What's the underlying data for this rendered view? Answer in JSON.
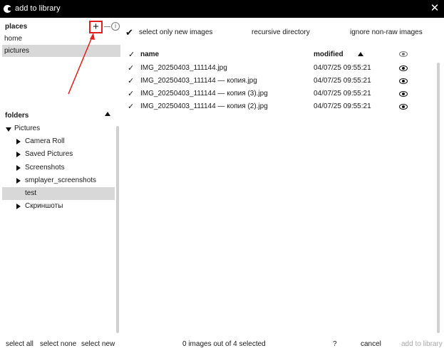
{
  "window": {
    "title": "add to library",
    "close_glyph": "✕"
  },
  "places": {
    "title": "places",
    "add_glyph": "+",
    "info_glyph": "i",
    "items": [
      {
        "label": "home",
        "selected": false
      },
      {
        "label": "pictures",
        "selected": true
      }
    ]
  },
  "folders": {
    "title": "folders",
    "root": {
      "label": "Pictures",
      "expanded": true
    },
    "items": [
      {
        "label": "Camera Roll",
        "has_children": true,
        "selected": false
      },
      {
        "label": "Saved Pictures",
        "has_children": true,
        "selected": false
      },
      {
        "label": "Screenshots",
        "has_children": true,
        "selected": false
      },
      {
        "label": "smplayer_screenshots",
        "has_children": true,
        "selected": false
      },
      {
        "label": "test",
        "has_children": false,
        "selected": true
      },
      {
        "label": "Скриншоты",
        "has_children": true,
        "selected": false
      }
    ]
  },
  "options": {
    "select_only_new": {
      "label": "select only new images",
      "checked": true,
      "glyph": "✔"
    },
    "recursive": {
      "label": "recursive directory"
    },
    "ignore_non_raw": {
      "label": "ignore non-raw images"
    }
  },
  "files": {
    "columns": {
      "check": "✓",
      "name": "name",
      "modified": "modified"
    },
    "rows": [
      {
        "check": "✓",
        "name": "IMG_20250403_111144.jpg",
        "modified": "04/07/25 09:55:21"
      },
      {
        "check": "✓",
        "name": "IMG_20250403_111144 — копия.jpg",
        "modified": "04/07/25 09:55:21"
      },
      {
        "check": "✓",
        "name": "IMG_20250403_111144 — копия (3).jpg",
        "modified": "04/07/25 09:55:21"
      },
      {
        "check": "✓",
        "name": "IMG_20250403_111144 — копия (2).jpg",
        "modified": "04/07/25 09:55:21"
      }
    ]
  },
  "footer": {
    "select_all": "select all",
    "select_none": "select none",
    "select_new": "select new",
    "status": "0 images out of 4 selected",
    "help": "?",
    "cancel": "cancel",
    "add": "add to library"
  },
  "colors": {
    "titlebar_bg": "#000000",
    "selection_bg": "#d8d8d8",
    "annotation_red": "#e02020",
    "disabled_text": "#a8a8a8"
  }
}
